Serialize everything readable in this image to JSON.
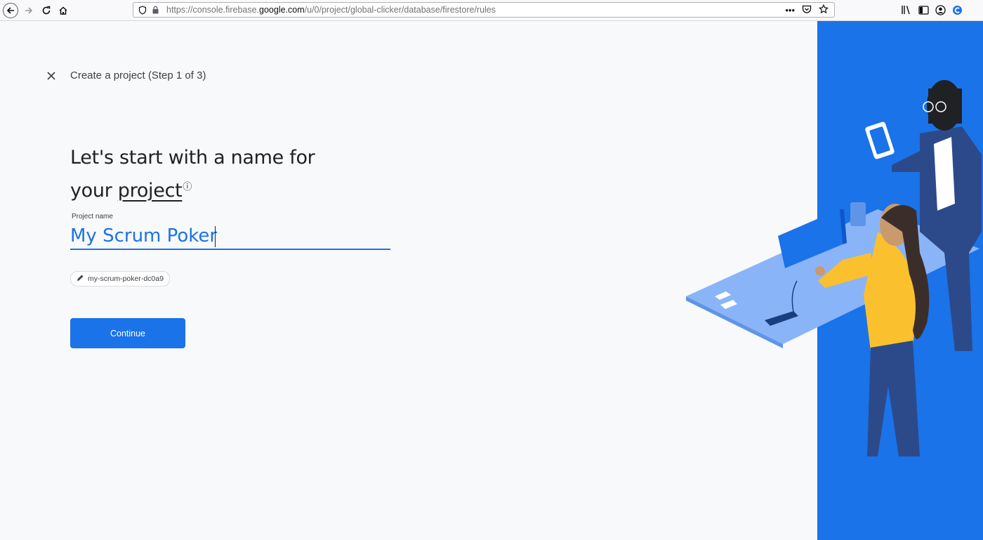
{
  "browser": {
    "url_prefix": "https://console.firebase.",
    "url_domain": "google.com",
    "url_path": "/u/0/project/global-clicker/database/firestore/rules",
    "icons": [
      "back-icon",
      "forward-icon",
      "reload-icon",
      "home-icon",
      "shield-icon",
      "lock-icon",
      "more-icon",
      "pocket-icon",
      "bookmark-star-icon",
      "library-icon",
      "sidebar-icon",
      "account-icon",
      "extension-icon"
    ]
  },
  "wizard": {
    "step_label": "Create a project (Step 1 of 3)",
    "heading_line1": "Let's start with a name for",
    "heading_line2_prefix": "your ",
    "heading_link": "project",
    "help_glyph": "?",
    "field_label": "Project name",
    "project_name": "My Scrum Poker",
    "project_id": "my-scrum-poker-dc0a9",
    "continue_label": "Continue"
  },
  "colors": {
    "accent": "#1a73e8",
    "page_bg": "#f8f9fa",
    "illustration_panel": "#1a73e8"
  }
}
